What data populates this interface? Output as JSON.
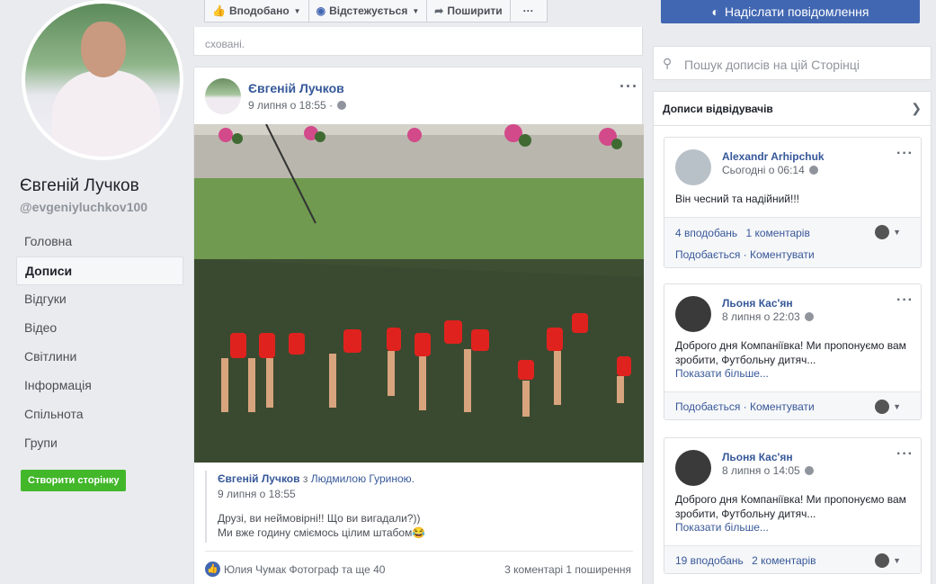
{
  "left": {
    "page_name": "Євгеній Лучков",
    "handle": "@evgeniyluchkov100",
    "nav": [
      "Головна",
      "Дописи",
      "Відгуки",
      "Відео",
      "Світлини",
      "Інформація",
      "Спільнота",
      "Групи"
    ],
    "active_nav": "Дописи",
    "create_page": "Створити сторінку"
  },
  "topbar": {
    "liked": "Вподобано",
    "following": "Відстежується",
    "share": "Поширити",
    "more": "···",
    "send_message": "Надіслати повідомлення"
  },
  "note": "сховані.",
  "post": {
    "author": "Євгеній Лучков",
    "time": "9 липня о 18:55",
    "shared_author": "Євгеній Лучков",
    "shared_with": "з",
    "shared_tag": "Людмилою Гуриною.",
    "shared_time": "9 липня о 18:55",
    "text_line1": "Друзі, ви неймовірні!! Що ви вигадали?))",
    "text_line2": "Ми вже годину сміємось цілим штабом😂",
    "reactions": "Юлия Чумак Фотограф та ще 40",
    "counts": "3 коментарі  1 поширення"
  },
  "right": {
    "search_placeholder": "Пошук дописів на цій Сторінці",
    "visitors_title": "Дописи відвідувачів",
    "posts": [
      {
        "name": "Alexandr Arhipchuk",
        "time": "Сьогодні о 06:14",
        "text": "Він чесний та надійний!!!",
        "more": "",
        "likes": "4 вподобань",
        "comments": "1 коментарів",
        "actions": "Подобається · Коментувати"
      },
      {
        "name": "Льоня Кас'ян",
        "time": "8 липня о 22:03",
        "text": "Доброго дня Компаніївка! Ми пропонуємо вам зробити, Футбольну дитяч...",
        "more": "Показати більше...",
        "likes": "",
        "comments": "",
        "actions": "Подобається · Коментувати"
      },
      {
        "name": "Льоня Кас'ян",
        "time": "8 липня о 14:05",
        "text": "Доброго дня Компаніївка! Ми пропонуємо вам зробити, Футбольну дитяч...",
        "more": "Показати більше...",
        "likes": "19 вподобань",
        "comments": "2 коментарів",
        "actions": ""
      }
    ]
  },
  "colors": {
    "brand": "#4267b2",
    "link": "#385898",
    "green_button": "#42b72a",
    "page_bg": "#e9ebee"
  }
}
